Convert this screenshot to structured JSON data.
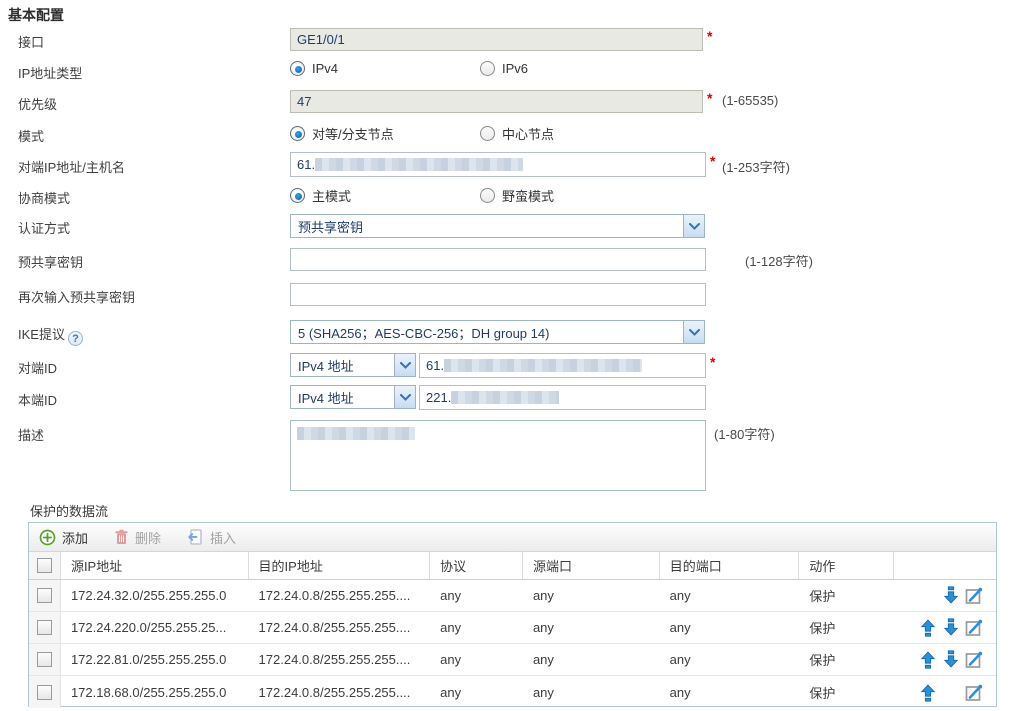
{
  "colors": {
    "accent_blue": "#2a8fd6",
    "required_red": "#e00000",
    "add_green": "#55a32a",
    "input_text_navy": "#1f3c68",
    "readonly_bg": "#e9e9e3",
    "table_border": "#aec6da"
  },
  "basic": {
    "section_title": "基本配置",
    "interface": {
      "label": "接口",
      "value": "GE1/0/1",
      "required": "*"
    },
    "ip_type": {
      "label": "IP地址类型",
      "option1": "IPv4",
      "option2": "IPv6",
      "selected": "IPv4"
    },
    "priority": {
      "label": "优先级",
      "value": "47",
      "required": "*",
      "hint": "(1-65535)"
    },
    "mode": {
      "label": "模式",
      "option1": "对等/分支节点",
      "option2": "中心节点",
      "selected": "对等/分支节点"
    },
    "peer_ip": {
      "label": "对端IP地址/主机名",
      "value_prefix": "61.",
      "redacted": true,
      "required": "*",
      "hint": "(1-253字符)"
    },
    "nego_mode": {
      "label": "协商模式",
      "option1": "主模式",
      "option2": "野蛮模式",
      "selected": "主模式"
    },
    "auth": {
      "label": "认证方式",
      "value": "预共享密钥"
    },
    "psk": {
      "label": "预共享密钥",
      "value": "",
      "hint": "(1-128字符)"
    },
    "psk_confirm": {
      "label": "再次输入预共享密钥",
      "value": ""
    },
    "ike": {
      "label": "IKE提议",
      "help_icon": "?",
      "value": "5 (SHA256；AES-CBC-256；DH group 14)"
    },
    "peer_id": {
      "label": "对端ID",
      "type_value": "IPv4 地址",
      "value_prefix": "61.",
      "redacted": true,
      "required": "*"
    },
    "local_id": {
      "label": "本端ID",
      "type_value": "IPv4 地址",
      "value_prefix": "221.",
      "redacted": true
    },
    "description": {
      "label": "描述",
      "redacted": true,
      "hint": "(1-80字符)"
    }
  },
  "flows": {
    "section_title": "保护的数据流",
    "toolbar": {
      "add": "添加",
      "delete": "删除",
      "insert": "插入",
      "add_enabled": true,
      "delete_enabled": false,
      "insert_enabled": false
    },
    "columns": {
      "src": "源IP地址",
      "dst": "目的IP地址",
      "proto": "协议",
      "sport": "源端口",
      "dport": "目的端口",
      "action": "动作"
    },
    "icons": {
      "add": "plus-circle",
      "delete": "trash",
      "insert": "insert-left-arrow",
      "move_up": "up-arrow",
      "move_down": "down-arrow",
      "edit": "pencil-square"
    },
    "rows": [
      {
        "src": "172.24.32.0/255.255.255.0",
        "dst": "172.24.0.8/255.255.255....",
        "proto": "any",
        "sport": "any",
        "dport": "any",
        "action": "保护",
        "can_up": false,
        "can_down": true
      },
      {
        "src": "172.24.220.0/255.255.25...",
        "dst": "172.24.0.8/255.255.255....",
        "proto": "any",
        "sport": "any",
        "dport": "any",
        "action": "保护",
        "can_up": true,
        "can_down": true
      },
      {
        "src": "172.22.81.0/255.255.255.0",
        "dst": "172.24.0.8/255.255.255....",
        "proto": "any",
        "sport": "any",
        "dport": "any",
        "action": "保护",
        "can_up": true,
        "can_down": true
      },
      {
        "src": "172.18.68.0/255.255.255.0",
        "dst": "172.24.0.8/255.255.255....",
        "proto": "any",
        "sport": "any",
        "dport": "any",
        "action": "保护",
        "can_up": true,
        "can_down": false
      }
    ]
  }
}
